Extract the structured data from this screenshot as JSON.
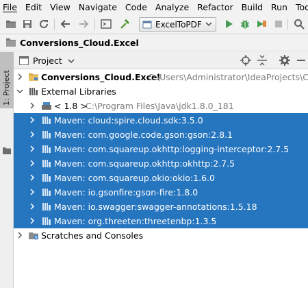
{
  "menubar": {
    "items": [
      "File",
      "Edit",
      "View",
      "Navigate",
      "Code",
      "Analyze",
      "Refactor",
      "Build",
      "Run",
      "Tools"
    ]
  },
  "toolbar": {
    "run_config": "ExcelToPDF",
    "icons": [
      "folder-open-icon",
      "save-all-icon",
      "sync-icon",
      "back-arrow-icon",
      "forward-arrow-icon",
      "structure-icon",
      "build-hammer-icon",
      "run-icon",
      "debug-bug-icon",
      "coverage-icon",
      "stop-icon",
      "search-icon"
    ]
  },
  "breadcrumb": {
    "project": "Conversions_Cloud.Excel"
  },
  "left_stripe": {
    "tab_label": "1: Project"
  },
  "project_panel": {
    "view_label": "Project",
    "header_icons": [
      "target-icon",
      "collapse-all-icon",
      "gear-icon",
      "hide-icon"
    ]
  },
  "tree": {
    "root": {
      "label": "Conversions_Cloud.Excel",
      "path": "C:\\Users\\Administrator\\IdeaProjects\\Con"
    },
    "external_libraries": "External Libraries",
    "jdk": {
      "label": "< 1.8 >",
      "path": "C:\\Program Files\\Java\\jdk1.8.0_181"
    },
    "libraries": [
      "Maven: cloud:spire.cloud.sdk:3.5.0",
      "Maven: com.google.code.gson:gson:2.8.1",
      "Maven: com.squareup.okhttp:logging-interceptor:2.7.5",
      "Maven: com.squareup.okhttp:okhttp:2.7.5",
      "Maven: com.squareup.okio:okio:1.6.0",
      "Maven: io.gsonfire:gson-fire:1.8.0",
      "Maven: io.swagger:swagger-annotations:1.5.18",
      "Maven: org.threeten:threetenbp:1.3.5"
    ],
    "scratches": "Scratches and Consoles"
  },
  "colors": {
    "selection": "#2675bf",
    "folder": "#d7a948",
    "run_green": "#499c54",
    "library_blue": "#4a88c7"
  }
}
